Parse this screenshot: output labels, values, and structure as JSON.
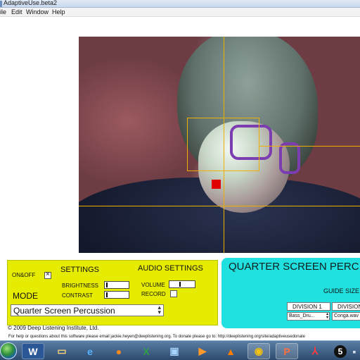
{
  "window": {
    "title": "AdaptiveUse.beta2"
  },
  "menu": [
    "ile",
    "Edit",
    "Window",
    "Help"
  ],
  "settings": {
    "on_off_label": "ON&OFF",
    "on_off_checked": true,
    "header": "SETTINGS",
    "audio_header": "AUDIO SETTINGS",
    "brightness_label": "BRIGHTNESS",
    "contrast_label": "CONTRAST",
    "volume_label": "VOLUME",
    "record_label": "RECORD",
    "record_checked": false,
    "mode_label": "MODE",
    "mode_value": "Quarter Screen Percussion"
  },
  "quarter": {
    "title": "QUARTER SCREEN PERC",
    "guide_label": "GUIDE SIZE",
    "divisions": [
      {
        "label": "DIVISION 1",
        "value": "Bass_Dru..."
      },
      {
        "label": "DIVISION",
        "value": "Conga.wav"
      }
    ]
  },
  "footer": {
    "copyright": "© 2009 Deep Listening Institute, Ltd.",
    "help": "For help or questions about this software please email jackie.heyen@deeplistening.org.  To donate please go to: http://deeplistening.org/site/adaptiveusedonate"
  },
  "taskbar": {
    "icons": [
      "start-orb",
      "word-icon",
      "explorer-icon",
      "ie-icon",
      "firefox-icon",
      "excel-icon",
      "media-icon",
      "itunes-icon",
      "vlc-icon",
      "chrome-icon",
      "powerpoint-icon",
      "acrobat-icon",
      "five-icon",
      "app-icon"
    ],
    "badge": "5"
  },
  "colors": {
    "settings_panel": "#e6ec00",
    "quarter_panel": "#21e0e0",
    "guide_lines": "#f0b000",
    "marker": "#e00000"
  }
}
